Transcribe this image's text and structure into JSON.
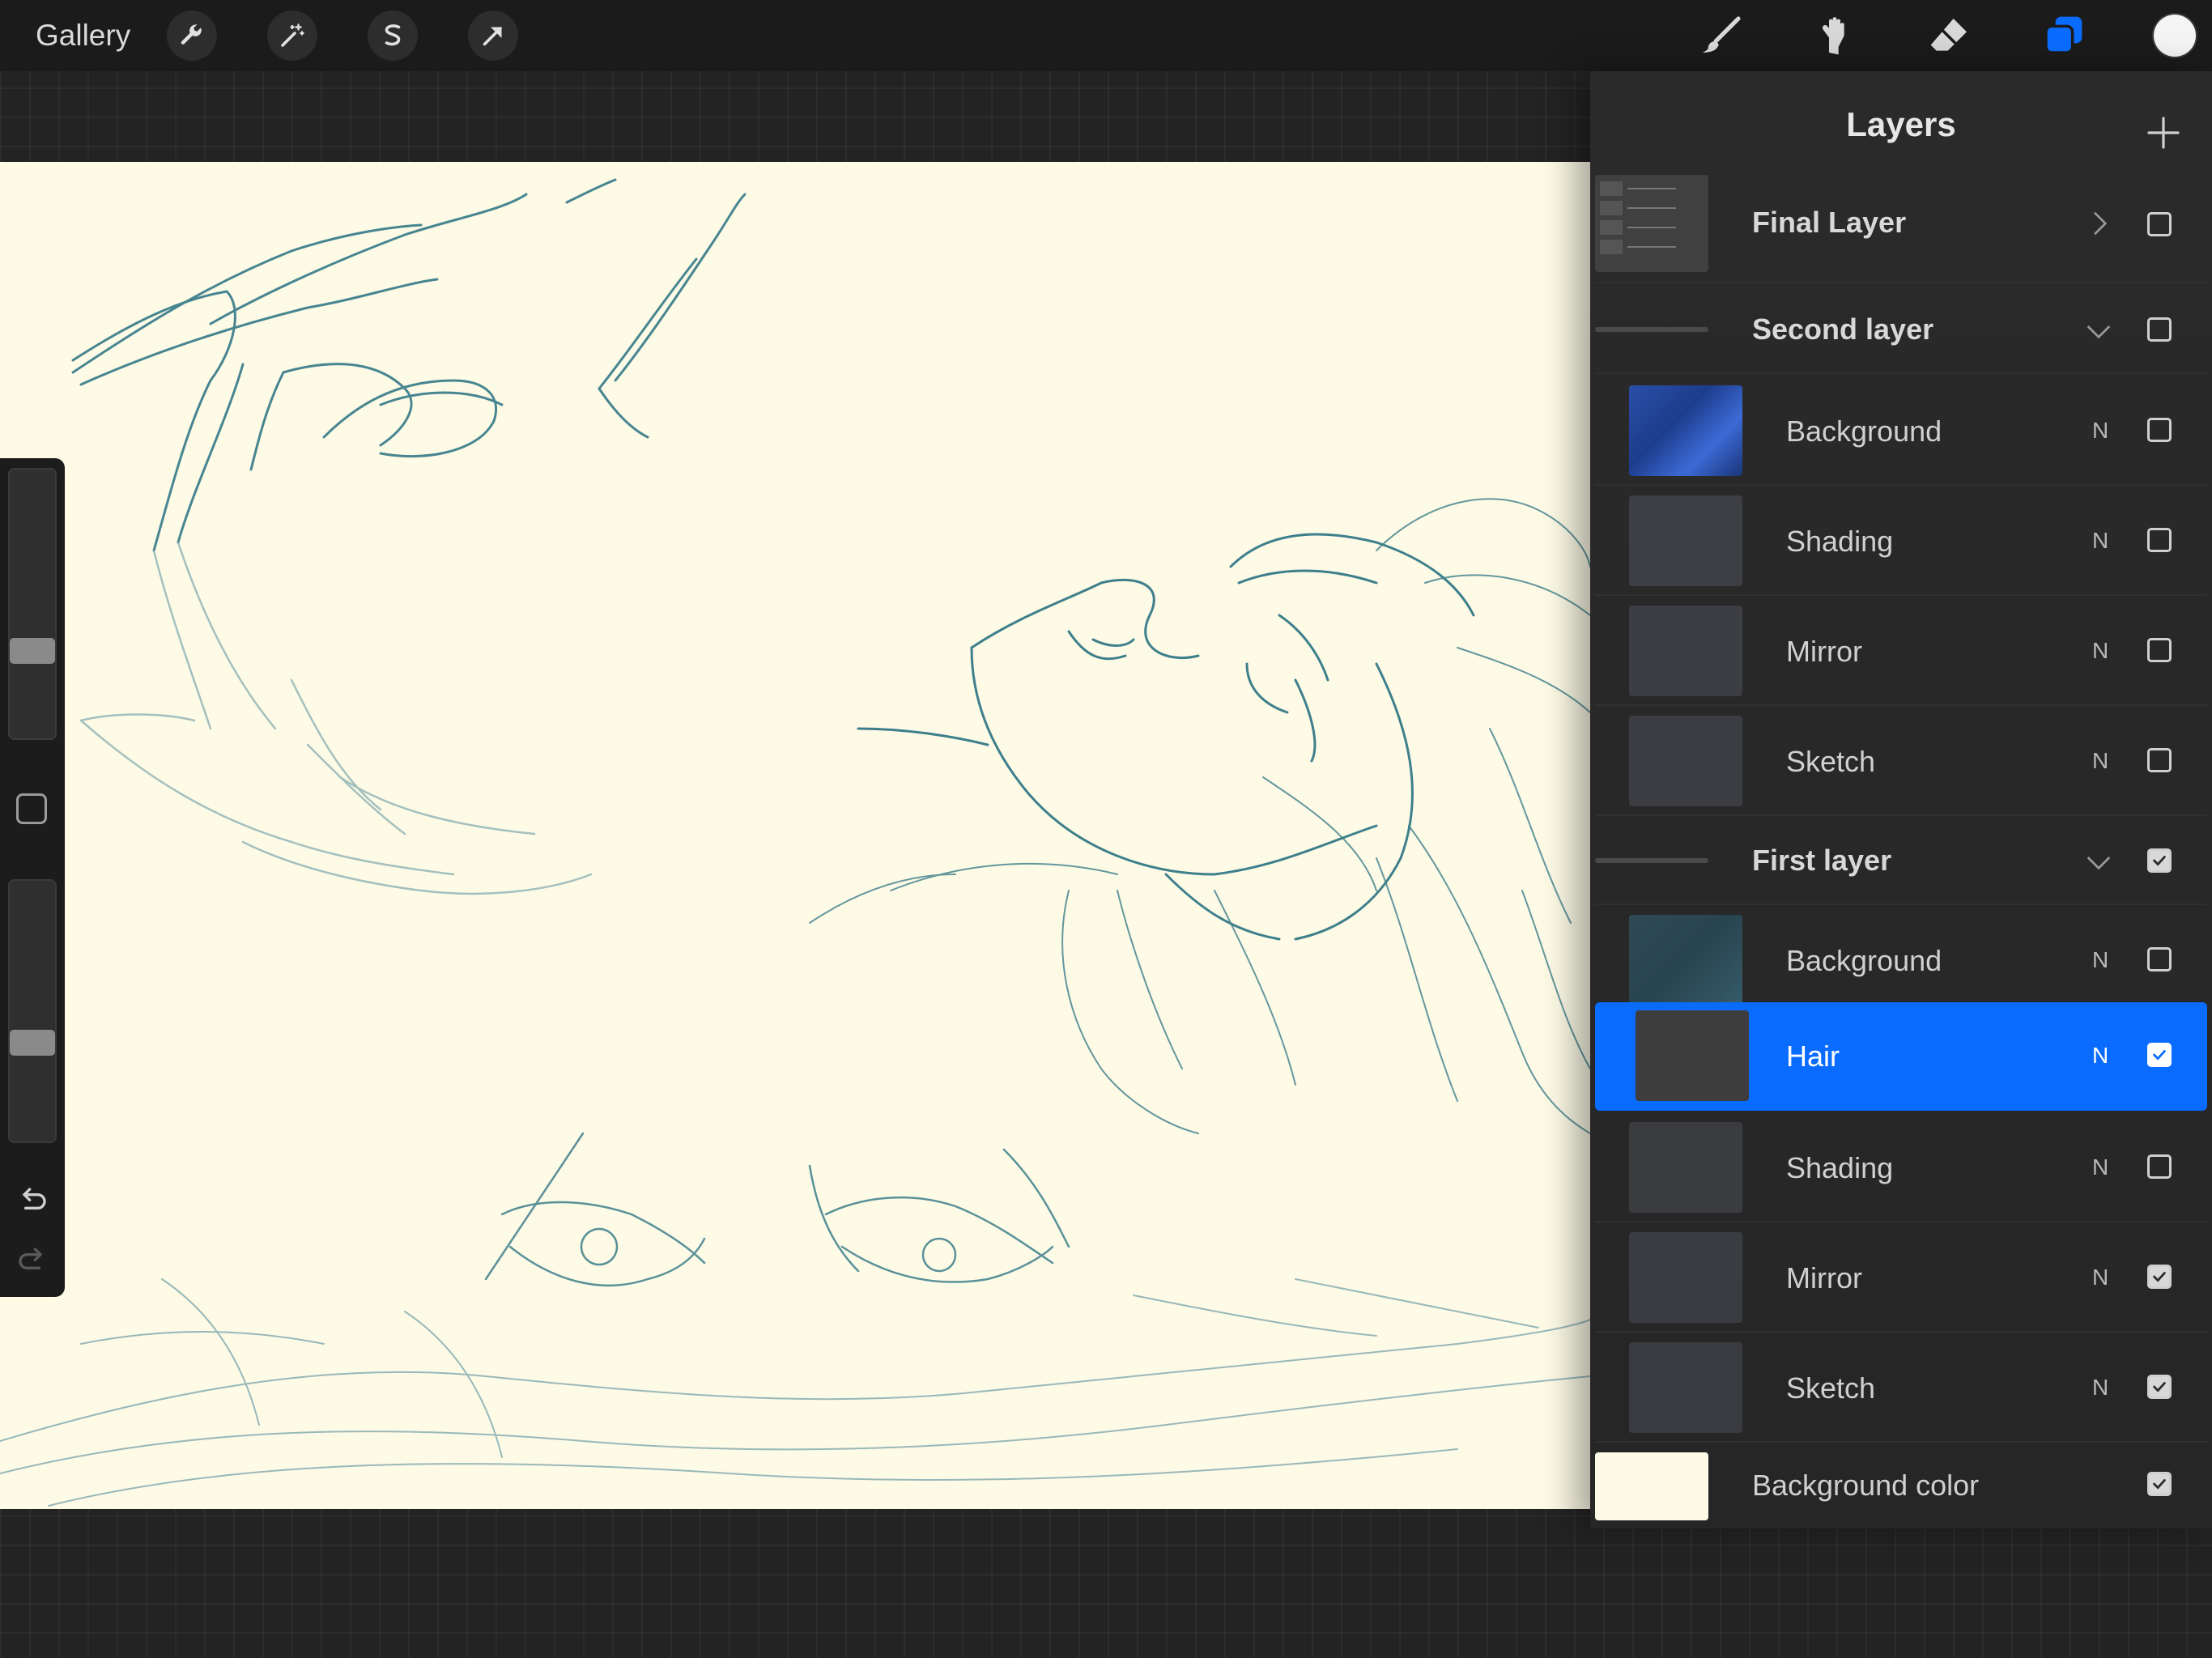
{
  "topbar": {
    "gallery_label": "Gallery",
    "left_tools": [
      "wrench-icon",
      "magic-wand-icon",
      "selection-s-icon",
      "transform-arrow-icon"
    ],
    "right_tools": [
      "brush-icon",
      "smudge-icon",
      "eraser-icon",
      "layers-icon"
    ],
    "accent_color": "#0a6cff",
    "current_color": "#f5f5f5"
  },
  "side_toolbar": {
    "brush_size_level": 0.62,
    "opacity_level": 0.58,
    "icons": [
      "modify-square-icon",
      "undo-icon",
      "redo-icon"
    ]
  },
  "canvas": {
    "background": "#fdfae6",
    "stroke_color": "#3e7f8c"
  },
  "layers_panel": {
    "title": "Layers",
    "add_icon": "plus-icon",
    "rows": [
      {
        "name": "Final Layer",
        "kind": "group",
        "expand": "chevron-right-icon",
        "checked": false
      },
      {
        "name": "Second layer",
        "kind": "group",
        "expand": "chevron-down-icon",
        "checked": false
      },
      {
        "name": "Background",
        "kind": "layer",
        "blend": "N",
        "checked": false
      },
      {
        "name": "Shading",
        "kind": "layer",
        "blend": "N",
        "checked": false
      },
      {
        "name": "Mirror",
        "kind": "layer",
        "blend": "N",
        "checked": false
      },
      {
        "name": "Sketch",
        "kind": "layer",
        "blend": "N",
        "checked": false
      },
      {
        "name": "First layer",
        "kind": "group",
        "expand": "chevron-down-icon",
        "checked": true
      },
      {
        "name": "Background",
        "kind": "layer",
        "blend": "N",
        "checked": false
      },
      {
        "name": "Hair",
        "kind": "layer",
        "blend": "N",
        "checked": true,
        "selected": true
      },
      {
        "name": "Shading",
        "kind": "layer",
        "blend": "N",
        "checked": false
      },
      {
        "name": "Mirror",
        "kind": "layer",
        "blend": "N",
        "checked": true
      },
      {
        "name": "Sketch",
        "kind": "layer",
        "blend": "N",
        "checked": true
      },
      {
        "name": "Background color",
        "kind": "background",
        "checked": true,
        "swatch": "#fdfae6"
      }
    ]
  }
}
